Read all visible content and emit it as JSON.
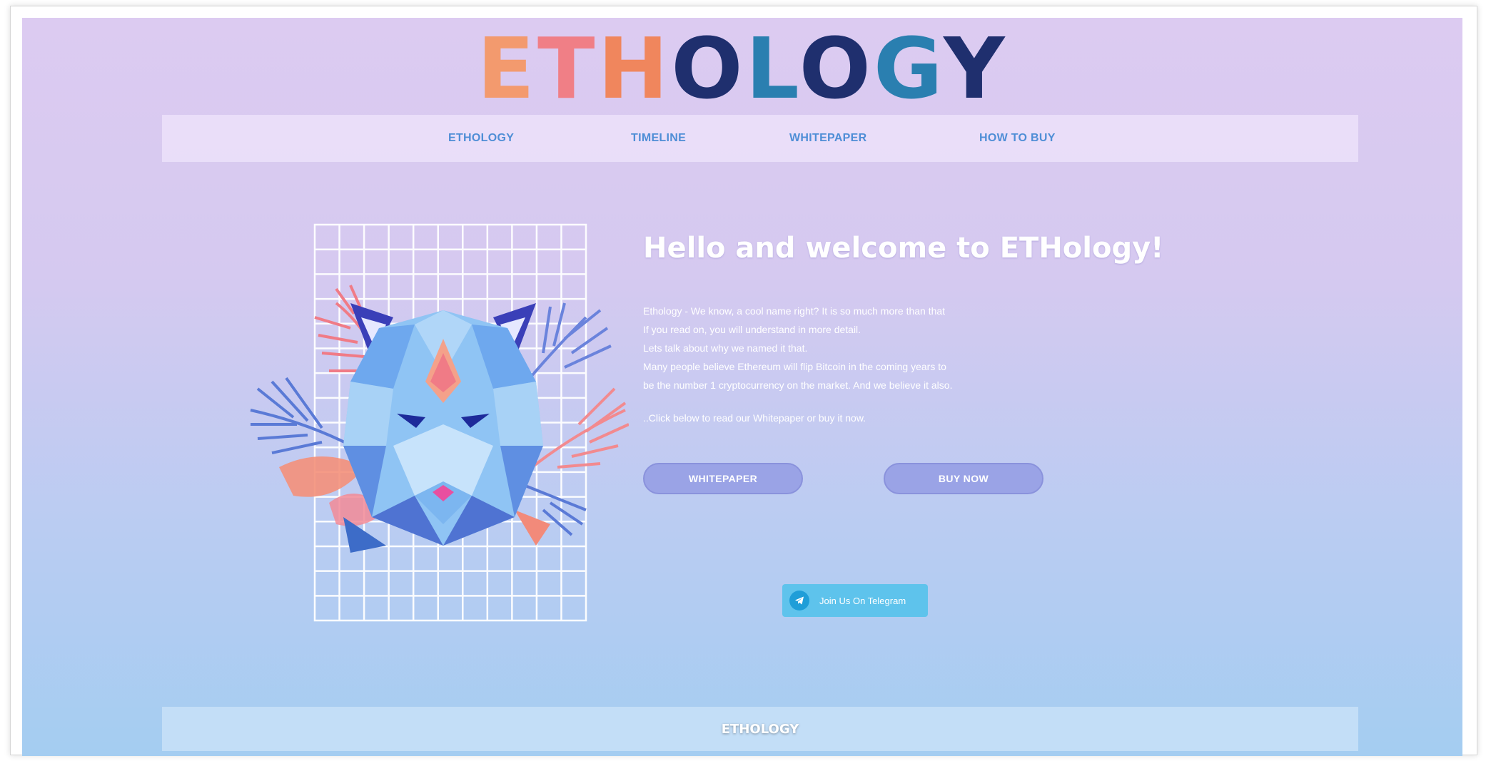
{
  "logo": {
    "eth": [
      "E",
      "T",
      "H"
    ],
    "ology": [
      "O",
      "L",
      "O",
      "G",
      "Y"
    ]
  },
  "nav": {
    "items": [
      {
        "label": "ETHOLOGY"
      },
      {
        "label": "TIMELINE"
      },
      {
        "label": "WHITEPAPER"
      },
      {
        "label": "HOW TO BUY"
      }
    ]
  },
  "hero": {
    "title": "Hello and welcome to ETHology!",
    "paragraphs": [
      "Ethology - We know, a cool name right? It is so much more than that",
      "If you read on, you will understand in more detail.",
      "Lets talk about why we named it that.",
      "Many people believe Ethereum will flip Bitcoin in the coming years to",
      "be the number 1 cryptocurrency on the market. And we believe it also."
    ],
    "cta_text": "..Click below to read our Whitepaper or buy it now.",
    "whitepaper_button": "WHITEPAPER",
    "buy_button": "BUY NOW",
    "telegram_label": "Join Us On Telegram",
    "illustration": "geometric-tiger-with-leaves-icon"
  },
  "footer": {
    "label": "ETHOLOGY"
  },
  "colors": {
    "nav_text": "#4f8ed6",
    "button_bg": "#9aa3e6",
    "telegram_bg": "#5ec3ec",
    "bg_top": "#dccbf1",
    "bg_bottom": "#a4cdf1"
  }
}
